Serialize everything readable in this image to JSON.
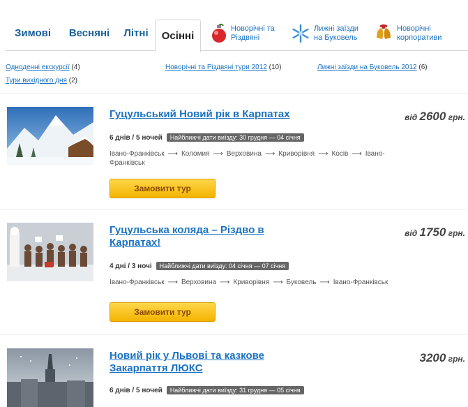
{
  "tabs": [
    {
      "label": "Зимові"
    },
    {
      "label": "Весняні"
    },
    {
      "label": "Літні"
    },
    {
      "label": "Осінні"
    }
  ],
  "special_tabs": [
    {
      "line1": "Новорічні та",
      "line2": "Різдвяні",
      "icon": "christmas-ornament-icon"
    },
    {
      "line1": "Лижні заїзди",
      "line2": "на Буковель",
      "icon": "snowflake-icon"
    },
    {
      "line1": "Новорічні",
      "line2": "корпоративи",
      "icon": "bells-icon"
    }
  ],
  "sublinks": [
    {
      "label": "Одноденні екскурсії",
      "count": "(4)"
    },
    {
      "label": "Новорічні та Різдвяні тури 2012",
      "count": "(10)"
    },
    {
      "label": "Лижні заїзди на Буковель 2012",
      "count": "(6)"
    },
    {
      "label": "Тури вихідного дня",
      "count": "(2)"
    }
  ],
  "tours": [
    {
      "title": "Гуцульський Новий рік в Карпатах",
      "price_prefix": "від",
      "price": "2600",
      "currency": "грн.",
      "duration": "6 днів / 5 ночей",
      "badge": "Найближчі дати виїзду: 30 грудня — 04 січня",
      "route": [
        "Івано-Франківськ",
        "Коломия",
        "Верховина",
        "Криворівня",
        "Косів",
        "Івано-Франківськ"
      ],
      "button": "Замовити тур"
    },
    {
      "title": "Гуцульська коляда – Різдво в Карпатах!",
      "price_prefix": "від",
      "price": "1750",
      "currency": "грн.",
      "duration": "4 дні / 3 ночі",
      "badge": "Найближчі дати виїзду: 04 січня — 07 січня",
      "route": [
        "Івано-Франківськ",
        "Верховина",
        "Криворівня",
        "Буковель",
        "Івано-Франківськ"
      ],
      "button": "Замовити тур"
    },
    {
      "title": "Новий рік у Львові та казкове Закарпаття ЛЮКС",
      "price_prefix": "",
      "price": "3200",
      "currency": "грн.",
      "duration": "6 днів / 5 ночей",
      "badge": "Найближчі дати виїзду: 31 грудня — 05 січня"
    }
  ],
  "route_arrow": "⟶"
}
